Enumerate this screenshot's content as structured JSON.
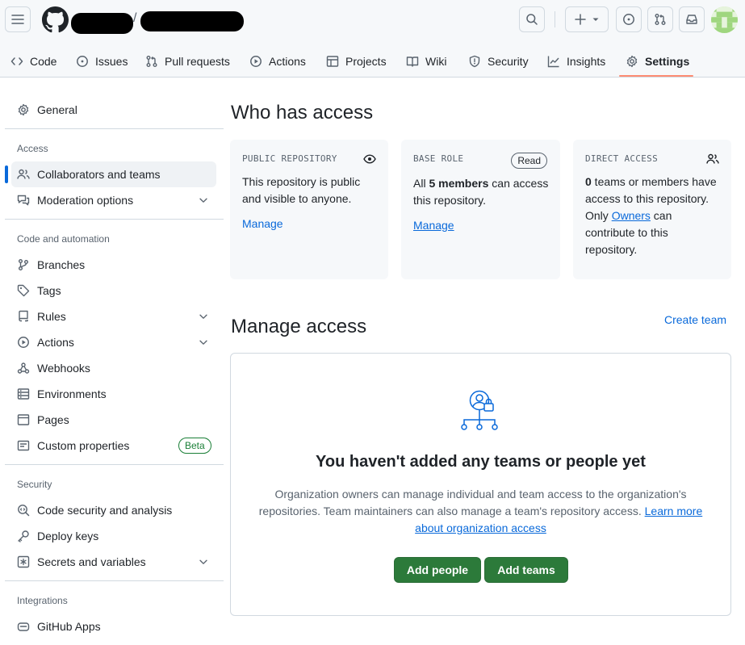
{
  "nav": {
    "tabs": [
      {
        "label": "Code",
        "icon": "code-icon"
      },
      {
        "label": "Issues",
        "icon": "issue-opened-icon"
      },
      {
        "label": "Pull requests",
        "icon": "git-pull-request-icon"
      },
      {
        "label": "Actions",
        "icon": "play-icon"
      },
      {
        "label": "Projects",
        "icon": "table-icon"
      },
      {
        "label": "Wiki",
        "icon": "book-icon"
      },
      {
        "label": "Security",
        "icon": "shield-icon"
      },
      {
        "label": "Insights",
        "icon": "graph-icon"
      },
      {
        "label": "Settings",
        "icon": "gear-icon"
      }
    ],
    "active_tab": "Settings",
    "breadcrumb_separator": "/"
  },
  "sidebar": {
    "general": "General",
    "sections": {
      "access": "Access",
      "code_automation": "Code and automation",
      "security": "Security",
      "integrations": "Integrations"
    },
    "items": {
      "collaborators": "Collaborators and teams",
      "moderation": "Moderation options",
      "branches": "Branches",
      "tags": "Tags",
      "rules": "Rules",
      "actions": "Actions",
      "webhooks": "Webhooks",
      "environments": "Environments",
      "pages": "Pages",
      "custom_properties": "Custom properties",
      "code_security": "Code security and analysis",
      "deploy_keys": "Deploy keys",
      "secrets": "Secrets and variables",
      "github_apps": "GitHub Apps"
    },
    "beta_badge": "Beta"
  },
  "main": {
    "title": "Who has access",
    "cards": {
      "public": {
        "label": "PUBLIC REPOSITORY",
        "line1": "This repository is public",
        "line2": "and visible to anyone.",
        "link": "Manage"
      },
      "base_role": {
        "label": "BASE ROLE",
        "badge": "Read",
        "pre": "All ",
        "count": "5 members",
        "post": " can access",
        "line2": "this repository.",
        "link": "Manage"
      },
      "direct": {
        "label": "DIRECT ACCESS",
        "count": "0",
        "line1": " teams or members have",
        "line2": "access to this repository.",
        "line3_pre": "Only ",
        "owners_link": "Owners",
        "line3_post": " can",
        "line4": "contribute to this",
        "line5": "repository."
      }
    },
    "manage_title": "Manage access",
    "create_team": "Create team",
    "blankslate": {
      "title": "You haven't added any teams or people yet",
      "desc1": "Organization owners can manage individual and team access to the organization's",
      "desc2": "repositories. Team maintainers can also manage a team's repository access.",
      "learn_more_1": "Learn more",
      "learn_more_2": "about organization access",
      "add_people": "Add people",
      "add_teams": "Add teams"
    }
  },
  "colors": {
    "accent": "#0969da",
    "primary_button": "#2c7a3a",
    "active_underline": "#fd8c73",
    "muted_text": "#59636e",
    "border": "#d1d9e0"
  }
}
